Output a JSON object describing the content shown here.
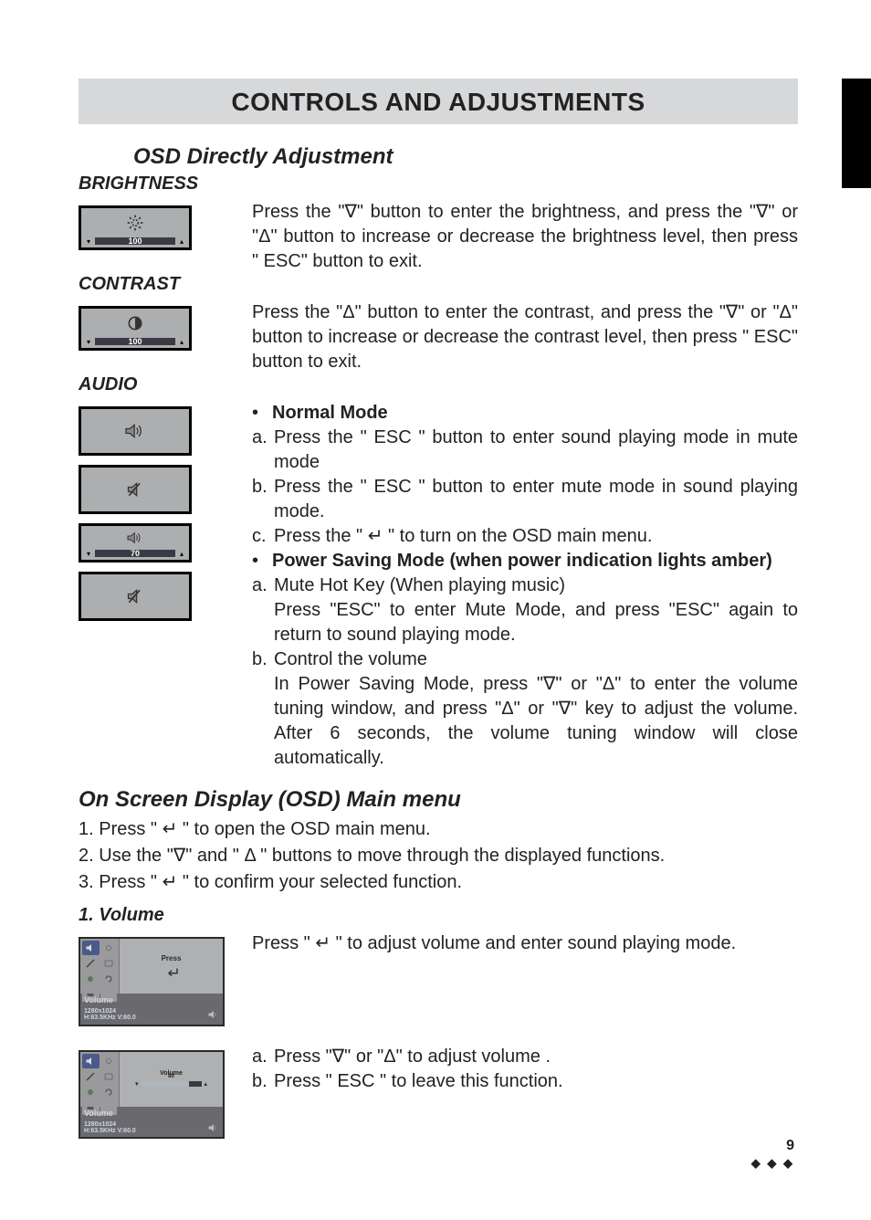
{
  "page": {
    "title": "CONTROLS AND ADJUSTMENTS",
    "number": "9",
    "diamonds": "◆ ◆ ◆"
  },
  "osd_direct": {
    "heading": "OSD Directly Adjustment",
    "brightness": {
      "label": "BRIGHTNESS",
      "value": "100",
      "text": "Press the \"∇\" button to enter the brightness, and press the \"∇\" or \"Δ\" button to increase or decrease the brightness level, then press \" ESC\" button to exit."
    },
    "contrast": {
      "label": "CONTRAST",
      "value": "100",
      "text": "Press the \"Δ\" button to enter the contrast, and press the \"∇\" or \"Δ\" button to increase or decrease the contrast level, then press \" ESC\" button to exit."
    },
    "audio": {
      "label": "AUDIO",
      "value": "70",
      "normal_mode_heading": "Normal Mode",
      "a": "Press the \" ESC \" button to enter sound playing mode in mute mode",
      "b": "Press the \" ESC \" button to enter mute mode in sound playing mode.",
      "c": "Press the \" ↵ \" to turn on the OSD main menu.",
      "power_mode_heading": "Power Saving Mode (when power indication lights amber)",
      "pa_label": "Mute Hot Key (When playing music)",
      "pa_text": "Press \"ESC\" to enter Mute Mode, and press \"ESC\" again to return to sound playing mode.",
      "pb_label": "Control the volume",
      "pb_text": "In Power Saving Mode, press \"∇\" or \"Δ\" to enter the volume tuning window, and press \"Δ\" or \"∇\" key to adjust the volume. After 6 seconds, the volume tuning window will close automatically."
    }
  },
  "osd_menu": {
    "heading": "On Screen Display (OSD) Main menu",
    "step1": "Press \" ↵ \" to open the OSD main menu.",
    "step2": "Use the \"∇\" and \" Δ \" buttons to move through the displayed functions.",
    "step3": "Press \" ↵ \" to confirm your selected function.",
    "volume": {
      "heading": "1.  Volume",
      "panel_press": "Press",
      "panel_label": "Volume",
      "panel_res": "1280x1024",
      "panel_hz": "H:63.5KHz V:60.0",
      "slider_label": "Volume",
      "slider_value": "80",
      "text1": "Press \" ↵ \" to adjust volume and enter sound playing mode.",
      "text2a": "Press \"∇\" or \"Δ\" to adjust volume .",
      "text2b": "Press \" ESC \" to leave this function."
    }
  }
}
